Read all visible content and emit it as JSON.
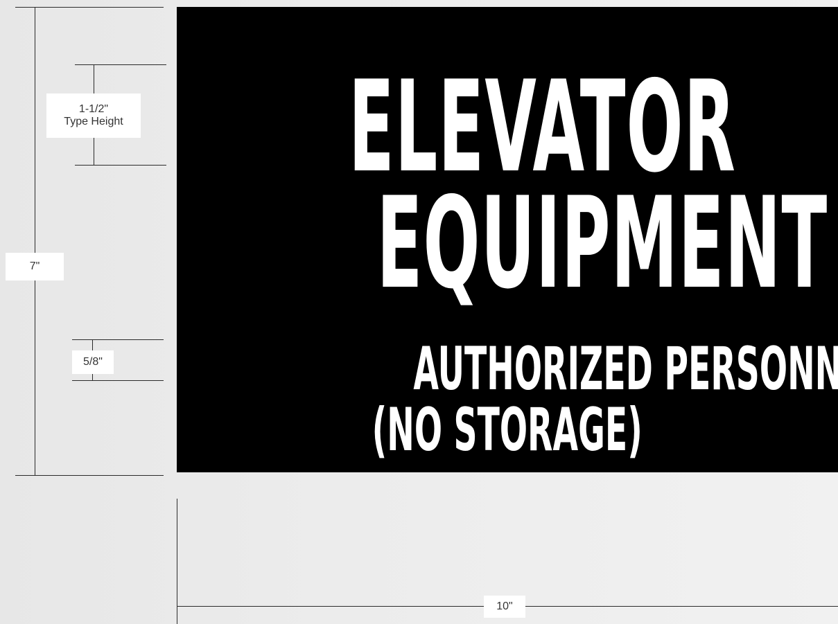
{
  "sign": {
    "line1": "ELEVATOR",
    "line2": "EQUIPMENT",
    "line3": "AUTHORIZED PERSONNEL ONLY",
    "line4": "(NO STORAGE)",
    "background_color": "#000000",
    "text_color": "#ffffff"
  },
  "dimensions": {
    "overall_height": "7\"",
    "type_height_value": "1-1/2\"",
    "type_height_caption": "Type Height",
    "subtext_height": "5/8\"",
    "overall_width": "10\""
  }
}
